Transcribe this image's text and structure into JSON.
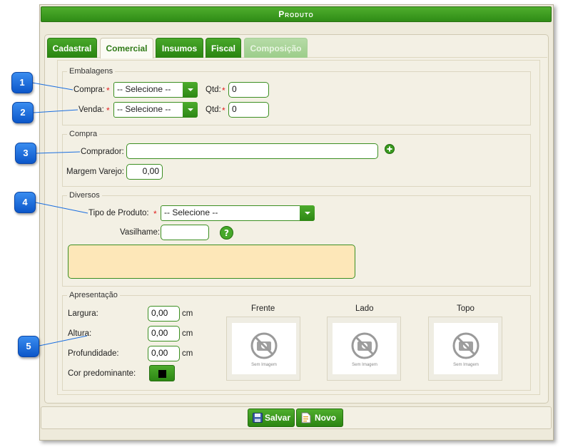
{
  "window": {
    "title": "Produto"
  },
  "tabs": [
    {
      "label": "Cadastral",
      "state": "normal"
    },
    {
      "label": "Comercial",
      "state": "active"
    },
    {
      "label": "Insumos",
      "state": "normal"
    },
    {
      "label": "Fiscal",
      "state": "normal"
    },
    {
      "label": "Composição",
      "state": "disabled"
    }
  ],
  "embalagens": {
    "legend": "Embalagens",
    "compra": {
      "label": "Compra:",
      "select_value": "-- Selecione --",
      "qtd_label": "Qtd:",
      "qtd_value": "0"
    },
    "venda": {
      "label": "Venda:",
      "select_value": "-- Selecione --",
      "qtd_label": "Qtd:",
      "qtd_value": "0"
    }
  },
  "compra": {
    "legend": "Compra",
    "comprador_label": "Comprador:",
    "comprador_value": "",
    "margem_label": "Margem Varejo:",
    "margem_value": "0,00"
  },
  "diversos": {
    "legend": "Diversos",
    "tipo_label": "Tipo de Produto:",
    "tipo_value": "-- Selecione --",
    "vasilhame_label": "Vasilhame:",
    "vasilhame_value": "",
    "notes_value": ""
  },
  "apresentacao": {
    "legend": "Apresentação",
    "largura_label": "Largura:",
    "largura_value": "0,00",
    "altura_label": "Altura:",
    "altura_value": "0,00",
    "profundidade_label": "Profundidade:",
    "profundidade_value": "0,00",
    "unit": "cm",
    "cor_label": "Cor predominante:",
    "cor_value": "#000000",
    "images": [
      {
        "title": "Frente",
        "placeholder": "Sem Imagem"
      },
      {
        "title": "Lado",
        "placeholder": "Sem Imagem"
      },
      {
        "title": "Topo",
        "placeholder": "Sem Imagem"
      }
    ]
  },
  "callouts": [
    "1",
    "2",
    "3",
    "4",
    "5"
  ],
  "buttons": {
    "save_label": "Salvar",
    "new_label": "Novo"
  },
  "colors": {
    "accent": "#3a9a1f",
    "required": "#e12020",
    "callout": "#1a6ee0",
    "notes_bg": "#fde7b8"
  }
}
